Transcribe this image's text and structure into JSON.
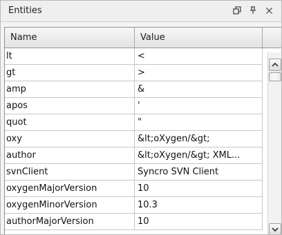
{
  "panel": {
    "title": "Entities",
    "buttons": {
      "restore_icon": "restore-window-icon",
      "pin_icon": "pin-icon",
      "close_icon": "close-icon"
    }
  },
  "table": {
    "columns": [
      "Name",
      "Value"
    ],
    "rows": [
      {
        "name": "lt",
        "value": "<"
      },
      {
        "name": "gt",
        "value": ">"
      },
      {
        "name": "amp",
        "value": "&"
      },
      {
        "name": "apos",
        "value": "'"
      },
      {
        "name": "quot",
        "value": "\""
      },
      {
        "name": "oxy",
        "value": "&lt;oXygen/&gt;"
      },
      {
        "name": "author",
        "value": "&lt;oXygen/&gt; XML..."
      },
      {
        "name": "svnClient",
        "value": "Syncro SVN Client"
      },
      {
        "name": "oxygenMajorVersion",
        "value": "10"
      },
      {
        "name": "oxygenMinorVersion",
        "value": "10.3"
      },
      {
        "name": "authorMajorVersion",
        "value": "10"
      }
    ]
  },
  "colors": {
    "border": "#8e8e8e",
    "header_bg": "#e9e9e9",
    "gridline": "#c6c6c6"
  }
}
